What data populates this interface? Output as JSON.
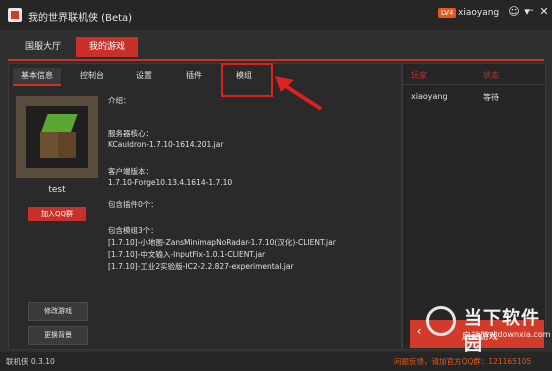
{
  "window": {
    "title": "我的世界联机侠 (Beta)",
    "level_badge": "LV4",
    "username": "xiaoyang",
    "icons": [
      "person-icon",
      "chevron-down-icon",
      "minimize-icon",
      "close-icon"
    ]
  },
  "main_tabs": [
    "国服大厅",
    "我的游戏"
  ],
  "sub_tabs": [
    "基本信息",
    "控制台",
    "设置",
    "插件",
    "模组"
  ],
  "profile": {
    "name": "test",
    "qq_label": "加入QQ群",
    "modify_label": "修改游戏",
    "background_label": "更换背景"
  },
  "info": {
    "intro_label": "介绍：",
    "server_core_label": "服务器核心：",
    "server_core": "KCauldron-1.7.10-1614.201.jar",
    "client_version_label": "客户端版本：",
    "client_version": "1.7.10-Forge10.13.4.1614-1.7.10",
    "plugins_label": "包含插件0个：",
    "mods_label": "包含模组3个：",
    "mods": [
      "[1.7.10]-小地图-ZansMinimapNoRadar-1.7.10(汉化)-CLIENT.jar",
      "[1.7.10]-中文输入-InputFix-1.0.1-CLIENT.jar",
      "[1.7.10]-工业2实验版-IC2-2.2.827-experimental.jar"
    ]
  },
  "players": {
    "header_player": "玩家",
    "header_status": "状态",
    "rows": [
      {
        "player": "xiaoyang",
        "status": "等待"
      }
    ]
  },
  "start_button": "启动游戏",
  "status": {
    "version": "联机侠 0.3.10",
    "feedback": "问题反馈，请加官方QQ群：121165105"
  },
  "watermark": {
    "main": "当下软件园",
    "sub": "www.downxia.com"
  },
  "colors": {
    "accent": "#c8302a",
    "highlight_box": "#e02020",
    "level_badge": "#e05a1a"
  }
}
